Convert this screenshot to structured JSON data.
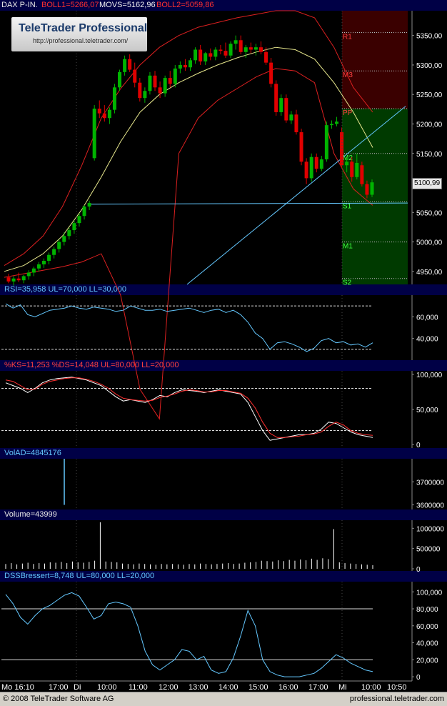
{
  "colors": {
    "background": "#000000",
    "header_bg": "#000046",
    "bull": "#00b400",
    "bear": "#e00000",
    "boll": "#dc2020",
    "movs": "#e6e68c",
    "cyan": "#64c8ff",
    "resist_zone": "#3a0000",
    "support_zone": "#003a00",
    "grid": "#555555",
    "label_gray": "#d0d0d0"
  },
  "branding": {
    "logo_title": "TeleTrader Professional",
    "logo_url": "http://professional.teletrader.com/"
  },
  "footer": {
    "copyright": "© 2008 TeleTrader Software AG",
    "url": "professional.teletrader.com"
  },
  "time_axis": {
    "labels": [
      "Mo 16:10",
      "17:00",
      "Di",
      "10:00",
      "11:00",
      "12:00",
      "13:00",
      "14:00",
      "15:00",
      "16:00",
      "17:00",
      "Mi",
      "10:00",
      "10:50"
    ]
  },
  "chart_data": [
    {
      "type": "candlestick",
      "panel": "price",
      "header": {
        "symbol": "DAX P-IN.",
        "boll1": "BOLL1=5266,07",
        "movs": "MOVS=5162,96",
        "boll2": "BOLL2=5059,86"
      },
      "last_price": "5100,99",
      "y_ticks": [
        "5350,00",
        "5300,00",
        "5250,00",
        "5200,00",
        "5150,00",
        "5100,00",
        "5050,00",
        "5000,00",
        "4950,00"
      ],
      "ylim": [
        4928,
        5392
      ],
      "pivot_levels": [
        {
          "name": "R1",
          "value": 5355
        },
        {
          "name": "M3",
          "value": 5290
        },
        {
          "name": "PP",
          "value": 5226
        },
        {
          "name": "M2",
          "value": 5150
        },
        {
          "name": "S1",
          "value": 5068
        },
        {
          "name": "M1",
          "value": 5000
        },
        {
          "name": "S2",
          "value": 4938
        }
      ],
      "candles": [
        {
          "o": 4940,
          "h": 4946,
          "l": 4930,
          "c": 4933
        },
        {
          "o": 4933,
          "h": 4942,
          "l": 4926,
          "c": 4938
        },
        {
          "o": 4938,
          "h": 4948,
          "l": 4932,
          "c": 4935
        },
        {
          "o": 4935,
          "h": 4944,
          "l": 4930,
          "c": 4942
        },
        {
          "o": 4942,
          "h": 4952,
          "l": 4936,
          "c": 4948
        },
        {
          "o": 4948,
          "h": 4958,
          "l": 4942,
          "c": 4955
        },
        {
          "o": 4955,
          "h": 4966,
          "l": 4950,
          "c": 4962
        },
        {
          "o": 4962,
          "h": 4972,
          "l": 4956,
          "c": 4968
        },
        {
          "o": 4968,
          "h": 4982,
          "l": 4962,
          "c": 4978
        },
        {
          "o": 4978,
          "h": 4992,
          "l": 4972,
          "c": 4988
        },
        {
          "o": 4988,
          "h": 5004,
          "l": 4982,
          "c": 5000
        },
        {
          "o": 5000,
          "h": 5016,
          "l": 4994,
          "c": 5010
        },
        {
          "o": 5010,
          "h": 5024,
          "l": 5004,
          "c": 5020
        },
        {
          "o": 5020,
          "h": 5036,
          "l": 5014,
          "c": 5032
        },
        {
          "o": 5032,
          "h": 5048,
          "l": 5026,
          "c": 5044
        },
        {
          "o": 5044,
          "h": 5062,
          "l": 5038,
          "c": 5060
        },
        {
          "o": 5060,
          "h": 5070,
          "l": 5054,
          "c": 5066
        },
        {
          "o": 5142,
          "h": 5232,
          "l": 5138,
          "c": 5226
        },
        {
          "o": 5226,
          "h": 5240,
          "l": 5210,
          "c": 5218
        },
        {
          "o": 5218,
          "h": 5232,
          "l": 5204,
          "c": 5210
        },
        {
          "o": 5210,
          "h": 5228,
          "l": 5200,
          "c": 5224
        },
        {
          "o": 5224,
          "h": 5268,
          "l": 5218,
          "c": 5262
        },
        {
          "o": 5262,
          "h": 5292,
          "l": 5256,
          "c": 5288
        },
        {
          "o": 5288,
          "h": 5316,
          "l": 5282,
          "c": 5310
        },
        {
          "o": 5310,
          "h": 5318,
          "l": 5288,
          "c": 5292
        },
        {
          "o": 5292,
          "h": 5304,
          "l": 5262,
          "c": 5270
        },
        {
          "o": 5270,
          "h": 5278,
          "l": 5238,
          "c": 5244
        },
        {
          "o": 5244,
          "h": 5262,
          "l": 5236,
          "c": 5256
        },
        {
          "o": 5256,
          "h": 5288,
          "l": 5250,
          "c": 5282
        },
        {
          "o": 5282,
          "h": 5290,
          "l": 5256,
          "c": 5262
        },
        {
          "o": 5262,
          "h": 5272,
          "l": 5244,
          "c": 5252
        },
        {
          "o": 5252,
          "h": 5282,
          "l": 5246,
          "c": 5278
        },
        {
          "o": 5278,
          "h": 5290,
          "l": 5262,
          "c": 5268
        },
        {
          "o": 5268,
          "h": 5300,
          "l": 5262,
          "c": 5294
        },
        {
          "o": 5294,
          "h": 5306,
          "l": 5286,
          "c": 5300
        },
        {
          "o": 5300,
          "h": 5310,
          "l": 5290,
          "c": 5296
        },
        {
          "o": 5296,
          "h": 5312,
          "l": 5290,
          "c": 5308
        },
        {
          "o": 5308,
          "h": 5330,
          "l": 5302,
          "c": 5326
        },
        {
          "o": 5326,
          "h": 5334,
          "l": 5300,
          "c": 5306
        },
        {
          "o": 5306,
          "h": 5322,
          "l": 5300,
          "c": 5320
        },
        {
          "o": 5320,
          "h": 5328,
          "l": 5308,
          "c": 5314
        },
        {
          "o": 5314,
          "h": 5330,
          "l": 5308,
          "c": 5326
        },
        {
          "o": 5326,
          "h": 5334,
          "l": 5318,
          "c": 5324
        },
        {
          "o": 5324,
          "h": 5338,
          "l": 5312,
          "c": 5316
        },
        {
          "o": 5316,
          "h": 5340,
          "l": 5312,
          "c": 5336
        },
        {
          "o": 5336,
          "h": 5350,
          "l": 5326,
          "c": 5342
        },
        {
          "o": 5342,
          "h": 5350,
          "l": 5318,
          "c": 5322
        },
        {
          "o": 5322,
          "h": 5334,
          "l": 5312,
          "c": 5330
        },
        {
          "o": 5330,
          "h": 5338,
          "l": 5320,
          "c": 5326
        },
        {
          "o": 5326,
          "h": 5336,
          "l": 5316,
          "c": 5330
        },
        {
          "o": 5330,
          "h": 5340,
          "l": 5318,
          "c": 5322
        },
        {
          "o": 5322,
          "h": 5330,
          "l": 5300,
          "c": 5304
        },
        {
          "o": 5304,
          "h": 5312,
          "l": 5262,
          "c": 5268
        },
        {
          "o": 5268,
          "h": 5274,
          "l": 5214,
          "c": 5220
        },
        {
          "o": 5220,
          "h": 5250,
          "l": 5214,
          "c": 5244
        },
        {
          "o": 5244,
          "h": 5250,
          "l": 5202,
          "c": 5206
        },
        {
          "o": 5206,
          "h": 5222,
          "l": 5200,
          "c": 5216
        },
        {
          "o": 5216,
          "h": 5224,
          "l": 5182,
          "c": 5186
        },
        {
          "o": 5186,
          "h": 5192,
          "l": 5130,
          "c": 5136
        },
        {
          "o": 5136,
          "h": 5142,
          "l": 5098,
          "c": 5108
        },
        {
          "o": 5108,
          "h": 5150,
          "l": 5102,
          "c": 5144
        },
        {
          "o": 5144,
          "h": 5150,
          "l": 5118,
          "c": 5124
        },
        {
          "o": 5124,
          "h": 5146,
          "l": 5120,
          "c": 5140
        },
        {
          "o": 5140,
          "h": 5204,
          "l": 5136,
          "c": 5198
        },
        {
          "o": 5198,
          "h": 5206,
          "l": 5192,
          "c": 5200
        },
        {
          "o": 5200,
          "h": 5212,
          "l": 5196,
          "c": 5204
        },
        {
          "o": 5186,
          "h": 5194,
          "l": 5124,
          "c": 5130
        },
        {
          "o": 5130,
          "h": 5142,
          "l": 5118,
          "c": 5136
        },
        {
          "o": 5136,
          "h": 5144,
          "l": 5102,
          "c": 5110
        },
        {
          "o": 5110,
          "h": 5150,
          "l": 5106,
          "c": 5134
        },
        {
          "o": 5130,
          "h": 5136,
          "l": 5094,
          "c": 5098
        },
        {
          "o": 5098,
          "h": 5104,
          "l": 5074,
          "c": 5080
        },
        {
          "o": 5080,
          "h": 5106,
          "l": 5076,
          "c": 5101
        }
      ],
      "boll_upper": [
        4960,
        4980,
        5010,
        5060,
        5130,
        5210,
        5260,
        5300,
        5330,
        5350,
        5364,
        5372,
        5380,
        5386,
        5392,
        5392,
        5380,
        5330,
        5262,
        5220
      ],
      "boll_lower": [
        4940,
        4946,
        4952,
        4958,
        4966,
        4980,
        4910,
        4750,
        4700,
        5150,
        5210,
        5240,
        5260,
        5280,
        5294,
        5290,
        5270,
        5150,
        5090,
        5062
      ],
      "movs": [
        4950,
        4960,
        4980,
        5010,
        5055,
        5110,
        5170,
        5220,
        5250,
        5270,
        5286,
        5300,
        5312,
        5322,
        5330,
        5326,
        5310,
        5270,
        5220,
        5160
      ]
    },
    {
      "type": "line",
      "panel": "rsi",
      "header": "RSI=35,958 UL=70,000 LL=30,000",
      "ylim": [
        20,
        80
      ],
      "y_ticks": [
        "60,000",
        "40,000"
      ],
      "levels": [
        70,
        30
      ],
      "series": [
        {
          "values": [
            72,
            68,
            71,
            62,
            60,
            63,
            66,
            67,
            68,
            70,
            68,
            67,
            69,
            68,
            67,
            65,
            66,
            70,
            68,
            66,
            66,
            67,
            65,
            66,
            67,
            68,
            66,
            64,
            66,
            67,
            64,
            66,
            62,
            55,
            45,
            40,
            30,
            36,
            37,
            35,
            32,
            28,
            31,
            38,
            40,
            36,
            37,
            34,
            35,
            32,
            36
          ]
        }
      ]
    },
    {
      "type": "line",
      "panel": "stochastic",
      "header": "%KS=11,253 %DS=14,048 UL=80,000 LL=20,000",
      "ylim": [
        -5,
        105
      ],
      "y_ticks": [
        "100,000",
        "50,000",
        "0"
      ],
      "levels": [
        80,
        20
      ],
      "series": [
        {
          "name": "%KS",
          "values": [
            88,
            84,
            80,
            74,
            80,
            88,
            92,
            94,
            95,
            96,
            94,
            92,
            88,
            84,
            76,
            68,
            62,
            64,
            62,
            60,
            64,
            70,
            68,
            74,
            78,
            77,
            76,
            74,
            76,
            78,
            76,
            74,
            72,
            60,
            40,
            20,
            6,
            8,
            10,
            12,
            14,
            14,
            16,
            22,
            32,
            30,
            24,
            18,
            14,
            12,
            10
          ]
        },
        {
          "name": "%DS",
          "values": [
            92,
            90,
            84,
            78,
            79,
            86,
            90,
            92,
            94,
            95,
            95,
            93,
            90,
            86,
            80,
            72,
            66,
            64,
            63,
            62,
            63,
            67,
            69,
            72,
            76,
            78,
            77,
            75,
            75,
            77,
            77,
            75,
            73,
            66,
            52,
            32,
            16,
            10,
            10,
            11,
            12,
            14,
            15,
            18,
            26,
            32,
            28,
            20,
            16,
            14,
            13
          ]
        }
      ]
    },
    {
      "type": "line",
      "panel": "volad",
      "header": "VolAD=4845176",
      "ylim": [
        3580000,
        3800000
      ],
      "y_ticks": [
        "3700000",
        "3600000"
      ],
      "series": [
        {
          "values": [
            3800000,
            3600000
          ]
        }
      ]
    },
    {
      "type": "bar",
      "panel": "volume",
      "header": "Volume=43999",
      "ylim": [
        0,
        1200000
      ],
      "y_ticks": [
        "1000000",
        "500000",
        "0"
      ],
      "values": [
        120000,
        140000,
        110000,
        130000,
        150000,
        120000,
        140000,
        130000,
        160000,
        150000,
        170000,
        140000,
        180000,
        160000,
        150000,
        170000,
        200000,
        1150000,
        180000,
        170000,
        160000,
        130000,
        120000,
        110000,
        130000,
        120000,
        110000,
        100000,
        120000,
        110000,
        120000,
        110000,
        100000,
        120000,
        110000,
        130000,
        120000,
        110000,
        120000,
        130000,
        140000,
        120000,
        130000,
        150000,
        160000,
        170000,
        200000,
        190000,
        180000,
        210000,
        190000,
        220000,
        200000,
        230000,
        210000,
        250000,
        220000,
        260000,
        240000,
        980000,
        160000,
        140000,
        130000,
        120000,
        110000,
        100000,
        90000
      ]
    },
    {
      "type": "line",
      "panel": "dss",
      "header": "DSSBressert=8,748 UL=80,000 LL=20,000",
      "ylim": [
        -5,
        112
      ],
      "y_ticks": [
        "100,000",
        "80,000",
        "60,000",
        "40,000",
        "20,000",
        "0"
      ],
      "levels": [
        80,
        20
      ],
      "series": [
        {
          "values": [
            97,
            86,
            70,
            62,
            72,
            80,
            84,
            90,
            96,
            99,
            95,
            82,
            68,
            72,
            86,
            88,
            86,
            82,
            60,
            30,
            14,
            8,
            14,
            20,
            32,
            30,
            20,
            24,
            8,
            4,
            6,
            22,
            48,
            78,
            60,
            20,
            6,
            2,
            0,
            0,
            0,
            2,
            4,
            10,
            18,
            26,
            22,
            16,
            12,
            8,
            6
          ]
        }
      ]
    }
  ]
}
